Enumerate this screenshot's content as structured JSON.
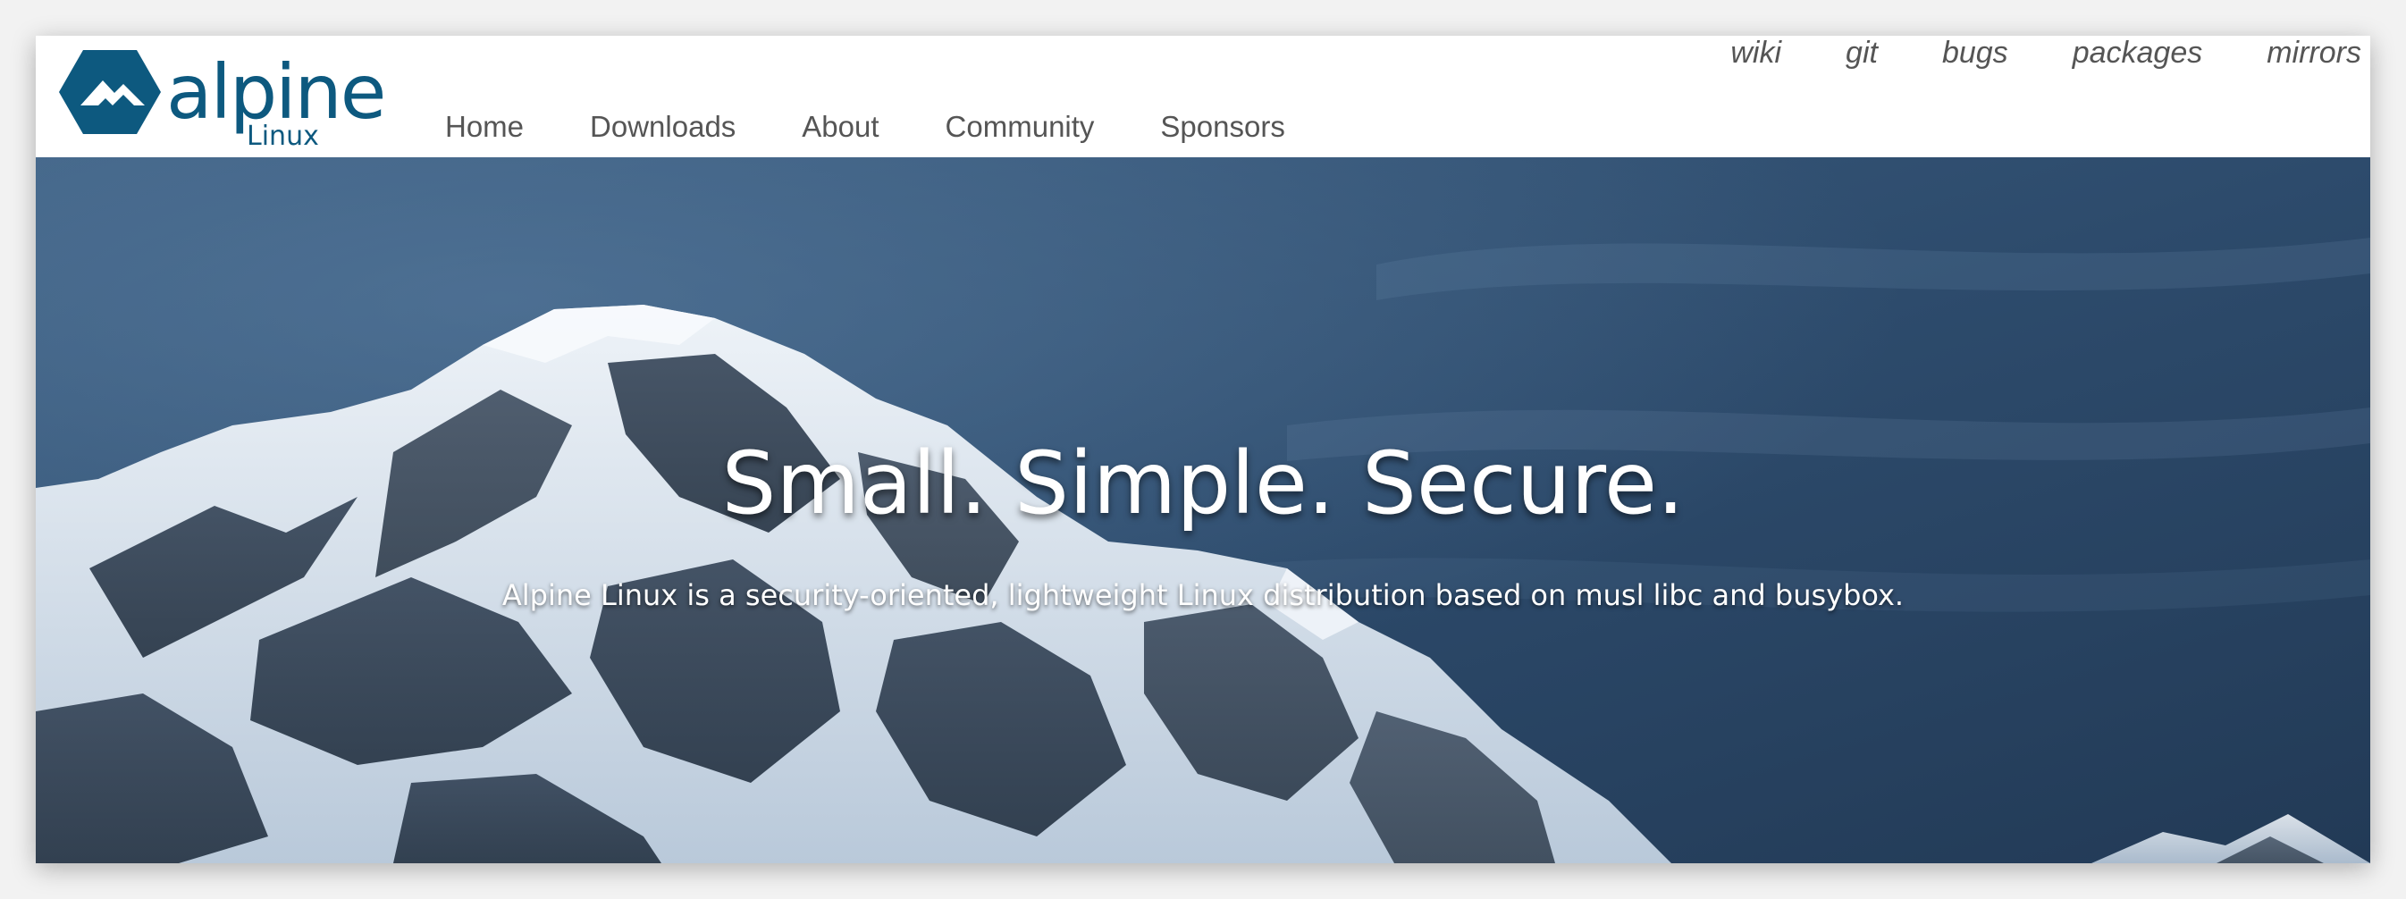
{
  "brand": {
    "name": "alpine",
    "tagline": "Linux",
    "color": "#0d597f"
  },
  "topnav": {
    "items": [
      {
        "label": "wiki"
      },
      {
        "label": "git"
      },
      {
        "label": "bugs"
      },
      {
        "label": "packages"
      },
      {
        "label": "mirrors"
      }
    ]
  },
  "mainnav": {
    "items": [
      {
        "label": "Home"
      },
      {
        "label": "Downloads"
      },
      {
        "label": "About"
      },
      {
        "label": "Community"
      },
      {
        "label": "Sponsors"
      }
    ]
  },
  "hero": {
    "title": "Small. Simple. Secure.",
    "subtitle": "Alpine Linux is a security-oriented, lightweight Linux distribution based on musl libc and busybox.",
    "sky_color": "#2b4866",
    "snow_color": "#dfe8f1"
  }
}
